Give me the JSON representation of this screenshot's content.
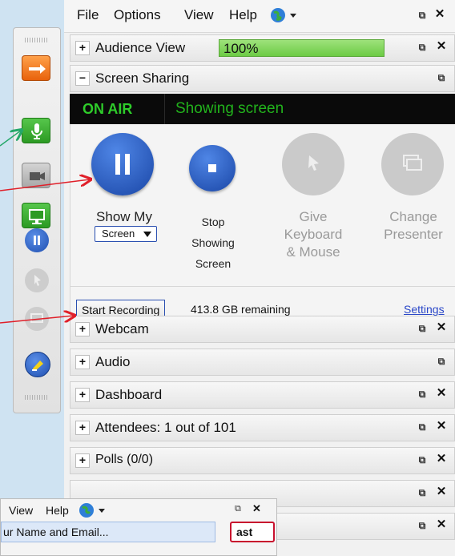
{
  "menu": {
    "file": "File",
    "options": "Options",
    "view": "View",
    "help": "Help"
  },
  "audience": {
    "label": "Audience View",
    "zoom": "100%"
  },
  "screen_sharing": {
    "label": "Screen Sharing",
    "status": "ON AIR",
    "status_detail": "Showing screen",
    "show_my": "Show My",
    "show_dropdown": "Screen",
    "stop_1": "Stop",
    "stop_2": "Showing",
    "stop_3": "Screen",
    "give_1": "Give",
    "give_2": "Keyboard",
    "give_3": "& Mouse",
    "change_1": "Change",
    "change_2": "Presenter",
    "start_recording": "Start Recording",
    "remaining": "413.8 GB remaining",
    "settings": "Settings"
  },
  "sections": {
    "webcam": "Webcam",
    "audio": "Audio",
    "dashboard": "Dashboard",
    "attendees": "Attendees:  1 out of 101",
    "polls": "Polls (0/0)"
  },
  "popup": {
    "view": "View",
    "help": "Help",
    "item": "ur Name and Email...",
    "button": "ast"
  },
  "colors": {
    "accent_blue": "#2a62c8",
    "on_air_green": "#22b31c",
    "arrow_red": "#e0202a",
    "arrow_green": "#25a86a"
  }
}
